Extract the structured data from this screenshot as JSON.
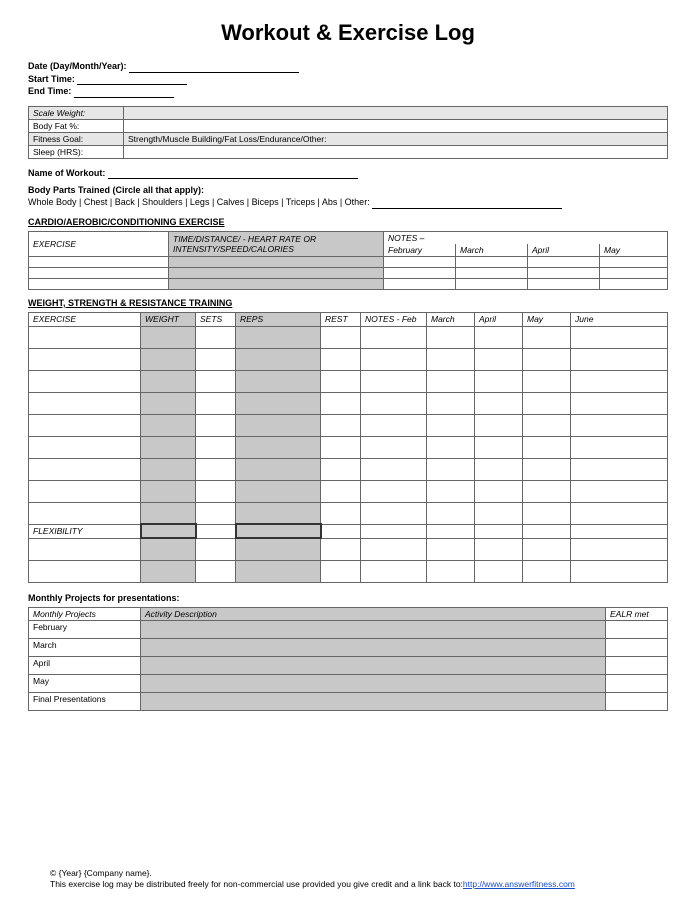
{
  "title": "Workout & Exercise Log",
  "fields": {
    "date_label": "Date (Day/Month/Year):",
    "start_time_label": "Start Time:",
    "end_time_label": "End Time:"
  },
  "info_table": {
    "scale_weight": "Scale Weight:",
    "body_fat": "Body Fat %:",
    "fitness_goal_label": "Fitness Goal:",
    "fitness_goal_value": "Strength/Muscle Building/Fat Loss/Endurance/Other:",
    "sleep": "Sleep (HRS):"
  },
  "workout_name_label": "Name of Workout:",
  "body_parts_heading": "Body Parts Trained (Circle all that apply):",
  "body_parts_list": "Whole Body | Chest | Back | Shoulders | Legs | Calves | Biceps | Triceps | Abs | Other:",
  "cardio": {
    "heading": "CARDIO/AEROBIC/CONDITIONING EXERCISE",
    "col_exercise": "EXERCISE",
    "col_time": "TIME/DISTANCE/ - HEART RATE OR INTENSITY/SPEED/CALORIES",
    "col_notes": "NOTES –",
    "months": [
      "February",
      "March",
      "April",
      "May"
    ]
  },
  "strength": {
    "heading": "WEIGHT, STRENGTH & RESISTANCE TRAINING",
    "col_exercise": "EXERCISE",
    "col_weight": "WEIGHT",
    "col_sets": "SETS",
    "col_reps": "REPS",
    "col_rest": "REST",
    "col_notes": "NOTES  - Feb",
    "months": [
      "March",
      "April",
      "May",
      "June"
    ],
    "flexibility": "FLEXIBILITY"
  },
  "projects": {
    "heading": "Monthly Projects for presentations:",
    "col_monthly": "Monthly Projects",
    "col_activity": "Activity Description",
    "col_ealr": "EALR met",
    "rows": [
      "February",
      "March",
      "April",
      "May",
      "Final Presentations"
    ]
  },
  "footer": {
    "copyright": "© {Year} {Company name}.",
    "distrib": "This exercise log may be distributed freely for non-commercial use provided you give credit and a link back to:",
    "link": "http://www.answerfitness.com"
  }
}
